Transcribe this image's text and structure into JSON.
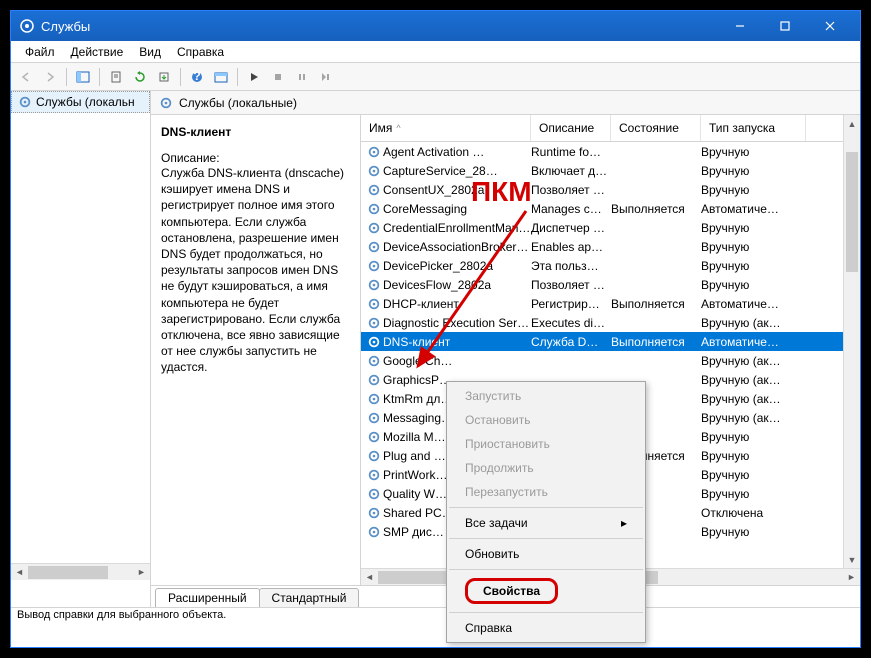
{
  "window": {
    "title": "Службы"
  },
  "menu": {
    "file": "Файл",
    "action": "Действие",
    "view": "Вид",
    "help": "Справка"
  },
  "left": {
    "root": "Службы (локальн"
  },
  "panelHeader": "Службы (локальные)",
  "selected": {
    "name": "DNS-клиент",
    "descLabel": "Описание:",
    "desc": "Служба DNS-клиента (dnscache) кэширует имена DNS и регистрирует полное имя этого компьютера. Если служба остановлена, разрешение имен DNS будет продолжаться, но результаты запросов имен DNS не будут кэшироваться, а имя компьютера не будет зарегистрировано. Если служба отключена, все явно зависящие от нее службы запустить не удастся."
  },
  "columns": {
    "name": "Имя",
    "desc": "Описание",
    "state": "Состояние",
    "start": "Тип запуска"
  },
  "rows": [
    {
      "name": "Agent Activation …",
      "desc": "Runtime fo…",
      "state": "",
      "start": "Вручную"
    },
    {
      "name": "CaptureService_28…",
      "desc": "Включает д…",
      "state": "",
      "start": "Вручную"
    },
    {
      "name": "ConsentUX_2802a",
      "desc": "Позволяет …",
      "state": "",
      "start": "Вручную"
    },
    {
      "name": "CoreMessaging",
      "desc": "Manages c…",
      "state": "Выполняется",
      "start": "Автоматиче…"
    },
    {
      "name": "CredentialEnrollmentMana…",
      "desc": "Диспетчер …",
      "state": "",
      "start": "Вручную"
    },
    {
      "name": "DeviceAssociationBroker_28…",
      "desc": "Enables ap…",
      "state": "",
      "start": "Вручную"
    },
    {
      "name": "DevicePicker_2802a",
      "desc": "Эта польз…",
      "state": "",
      "start": "Вручную"
    },
    {
      "name": "DevicesFlow_2802a",
      "desc": "Позволяет …",
      "state": "",
      "start": "Вручную"
    },
    {
      "name": "DHCP-клиент",
      "desc": "Регистрир…",
      "state": "Выполняется",
      "start": "Автоматиче…"
    },
    {
      "name": "Diagnostic Execution Service",
      "desc": "Executes di…",
      "state": "",
      "start": "Вручную (ак…"
    },
    {
      "name": "DNS-клиент",
      "desc": "Служба D…",
      "state": "Выполняется",
      "start": "Автоматиче…",
      "selected": true
    },
    {
      "name": "Google Ch…",
      "desc": "",
      "state": "",
      "start": "Вручную (ак…"
    },
    {
      "name": "GraphicsP…",
      "desc": "",
      "state": "",
      "start": "Вручную (ак…"
    },
    {
      "name": "KtmRm дл…",
      "desc": "",
      "state": "",
      "start": "Вручную (ак…"
    },
    {
      "name": "Messaging…",
      "desc": "",
      "state": "",
      "start": "Вручную (ак…"
    },
    {
      "name": "Mozilla M…",
      "desc": "",
      "state": "",
      "start": "Вручную"
    },
    {
      "name": "Plug and …",
      "desc": "",
      "state": "Выполняется",
      "start": "Вручную"
    },
    {
      "name": "PrintWork…",
      "desc": "",
      "state": "",
      "start": "Вручную"
    },
    {
      "name": "Quality W…",
      "desc": "",
      "state": "",
      "start": "Вручную"
    },
    {
      "name": "Shared PC…",
      "desc": "",
      "state": "",
      "start": "Отключена"
    },
    {
      "name": "SMP дис…",
      "desc": "",
      "state": "",
      "start": "Вручную"
    }
  ],
  "ctx": {
    "start": "Запустить",
    "stop": "Остановить",
    "pause": "Приостановить",
    "resume": "Продолжить",
    "restart": "Перезапустить",
    "alltasks": "Все задачи",
    "refresh": "Обновить",
    "props": "Свойства",
    "help": "Справка"
  },
  "tabs": {
    "extended": "Расширенный",
    "standard": "Стандартный"
  },
  "status": "Вывод справки для выбранного объекта.",
  "annotation": "ПКМ"
}
